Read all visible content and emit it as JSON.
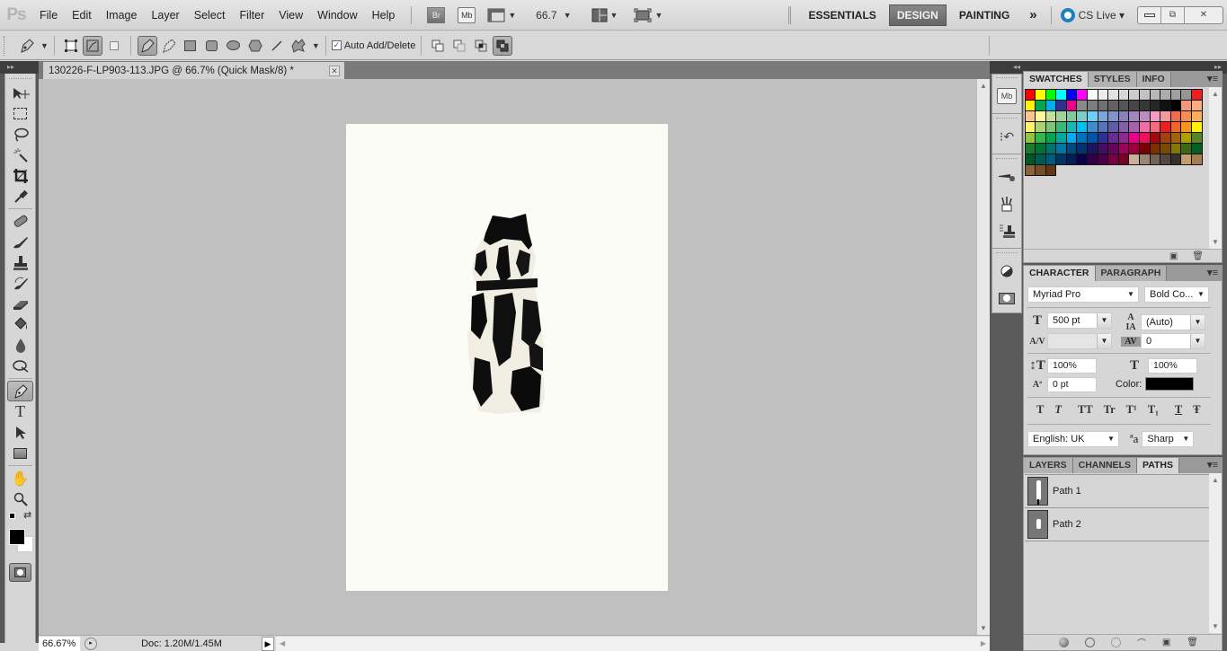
{
  "app": {
    "logo": "Ps"
  },
  "menu": {
    "items": [
      "File",
      "Edit",
      "Image",
      "Layer",
      "Select",
      "Filter",
      "View",
      "Window",
      "Help"
    ]
  },
  "appbar": {
    "bridge_label": "Br",
    "minibridge_label": "Mb",
    "zoom_level": "66.7",
    "workspaces": [
      "ESSENTIALS",
      "DESIGN",
      "PAINTING"
    ],
    "active_workspace": "DESIGN",
    "more_label": "»",
    "cslive_label": "CS Live ▾",
    "window_controls": [
      "minimize",
      "restore",
      "close"
    ]
  },
  "options_bar": {
    "auto_add_delete_label": "Auto Add/Delete",
    "auto_add_delete_checked": true,
    "check_mark": "✓"
  },
  "document": {
    "tab_title": "130226-F-LP903-113.JPG @ 66.7% (Quick Mask/8) *",
    "close_glyph": "✕",
    "canvas_color": "#fbfcf6"
  },
  "status": {
    "zoom": "66.67%",
    "doc_info": "Doc: 1.20M/1.45M",
    "arrow": "▶"
  },
  "tools": [
    "move-tool",
    "marquee-tool",
    "lasso-tool",
    "magic-wand-tool",
    "crop-tool",
    "eyedropper-tool",
    "healing-brush-tool",
    "brush-tool",
    "clone-stamp-tool",
    "history-brush-tool",
    "eraser-tool",
    "paint-bucket-tool",
    "blur-tool",
    "dodge-tool",
    "pen-tool",
    "type-tool",
    "path-selection-tool",
    "rectangle-tool",
    "hand-tool",
    "zoom-tool"
  ],
  "active_tool": "pen-tool",
  "colors": {
    "foreground": "#000000",
    "background": "#ffffff"
  },
  "swatches_panel": {
    "tabs": [
      "SWATCHES",
      "STYLES",
      "INFO"
    ],
    "active_tab": "SWATCHES",
    "colors": [
      "#ff0000",
      "#ffff00",
      "#00ff00",
      "#00ffff",
      "#0000ff",
      "#ff00ff",
      "#ffffff",
      "#ebebeb",
      "#e1e1e1",
      "#d7d7d7",
      "#cccccc",
      "#c2c2c2",
      "#b7b7b7",
      "#acacac",
      "#a0a0a0",
      "#959595",
      "#ee1d24",
      "#fff100",
      "#00a650",
      "#00aeef",
      "#2f3192",
      "#ed008c",
      "#898989",
      "#7d7d7d",
      "#707070",
      "#626262",
      "#555555",
      "#464646",
      "#363636",
      "#262626",
      "#111111",
      "#000000",
      "#f7977a",
      "#fbad82",
      "#fdc68c",
      "#fff799",
      "#c6df9c",
      "#a4d49d",
      "#81ca9d",
      "#7bcdc9",
      "#6ccff7",
      "#7ca6d8",
      "#8293ca",
      "#8881be",
      "#a286bd",
      "#bc8cbf",
      "#f49bc1",
      "#f5999d",
      "#f16c4d",
      "#f68e54",
      "#fbaf5a",
      "#fff467",
      "#acd372",
      "#7dc473",
      "#39b778",
      "#16bcb4",
      "#00bff3",
      "#438ccb",
      "#5573b7",
      "#5e5ca7",
      "#855fa8",
      "#a763a9",
      "#ef6ea8",
      "#f16d7e",
      "#ee1d24",
      "#f16522",
      "#f7941d",
      "#fff100",
      "#8fc63d",
      "#37b44a",
      "#00a650",
      "#00a99e",
      "#00aeef",
      "#0072bc",
      "#0054a5",
      "#2f3192",
      "#652c91",
      "#91278f",
      "#ed008c",
      "#ee105a",
      "#9d0a0f",
      "#a1410d",
      "#a36209",
      "#aba000",
      "#588528",
      "#197b30",
      "#007236",
      "#00736a",
      "#0076a4",
      "#004a80",
      "#003370",
      "#1d1363",
      "#450e61",
      "#62055f",
      "#9e005c",
      "#9d0039",
      "#790000",
      "#7b3000",
      "#7c4900",
      "#827a00",
      "#3e6617",
      "#045f20",
      "#005824",
      "#005951",
      "#005b7e",
      "#003562",
      "#002056",
      "#0c004b",
      "#30004a",
      "#4b0048",
      "#7a0045",
      "#7a0026",
      "#c7b299",
      "#998675",
      "#736357",
      "#534741",
      "#37302d",
      "#c69c6d",
      "#a67c52",
      "#8c6239",
      "#754c24",
      "#603913"
    ]
  },
  "character_panel": {
    "tabs": [
      "CHARACTER",
      "PARAGRAPH"
    ],
    "active_tab": "CHARACTER",
    "font_family": "Myriad Pro",
    "font_style": "Bold Co...",
    "font_size": "500 pt",
    "leading": "(Auto)",
    "kerning": "",
    "tracking": "0",
    "vertical_scale": "100%",
    "horizontal_scale": "100%",
    "baseline_shift": "0 pt",
    "color_label": "Color:",
    "color_value": "#000000",
    "style_buttons": [
      "T",
      "T",
      "TT",
      "Tr",
      "T¹",
      "T₁",
      "T",
      "Ŧ"
    ],
    "language": "English: UK",
    "antialias_icon": "ªa",
    "antialias": "Sharp"
  },
  "paths_panel": {
    "tabs": [
      "LAYERS",
      "CHANNELS",
      "PATHS"
    ],
    "active_tab": "PATHS",
    "paths": [
      {
        "name": "Path 1"
      },
      {
        "name": "Path 2"
      }
    ]
  },
  "dock_strip": {
    "mb_label": "Mb"
  }
}
